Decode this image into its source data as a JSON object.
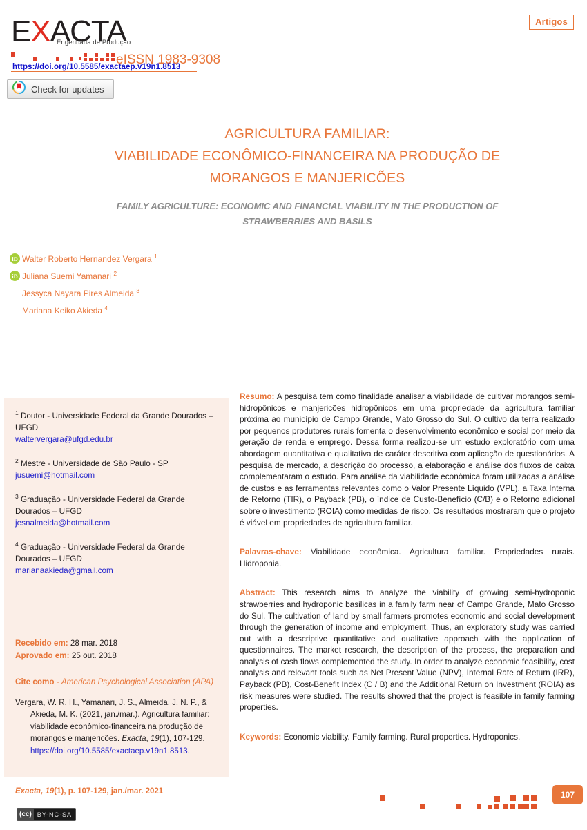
{
  "header": {
    "section_badge": "Artigos",
    "logo": {
      "wordmark_pre": "E",
      "wordmark_x": "X",
      "wordmark_post": "ACTA",
      "tagline": "Engenharia de Produção",
      "issn": "eISSN 1983-9308"
    },
    "doi_link": "https://doi.org/10.5585/exactaep.v19n1.8513",
    "crossmark_label": "Check for updates",
    "crossmark_icon": "crossmark-icon"
  },
  "title": {
    "pt_line1": "AGRICULTURA FAMILIAR:",
    "pt_line2": "VIABILIDADE ECONÔMICO-FINANCEIRA NA PRODUÇÃO DE",
    "pt_line3": "MORANGOS E MANJERICÕES",
    "en_line1": "FAMILY AGRICULTURE: ECONOMIC AND FINANCIAL VIABILITY IN THE PRODUCTION OF",
    "en_line2": "STRAWBERRIES AND BASILS"
  },
  "authors": [
    {
      "name": "Walter Roberto Hernandez Vergara",
      "marker": "1",
      "orcid": true,
      "orcid_label": "iD"
    },
    {
      "name": "Juliana Suemi Yamanari",
      "marker": "2",
      "orcid": true,
      "orcid_label": "iD"
    },
    {
      "name": "Jessyca Nayara Pires Almeida",
      "marker": "3",
      "orcid": false,
      "orcid_label": ""
    },
    {
      "name": "Mariana Keiko Akieda",
      "marker": "4",
      "orcid": false,
      "orcid_label": ""
    }
  ],
  "affiliations": [
    {
      "marker": "1",
      "text": "Doutor - Universidade Federal da Grande Dourados – UFGD",
      "email": "waltervergara@ufgd.edu.br"
    },
    {
      "marker": "2",
      "text": "Mestre - Universidade de São Paulo - SP",
      "email": "jusuemi@hotmail.com"
    },
    {
      "marker": "3",
      "text": "Graduação - Universidade Federal da Grande Dourados – UFGD",
      "email": "jesnalmeida@hotmail.com"
    },
    {
      "marker": "4",
      "text": "Graduação - Universidade Federal da Grande Dourados – UFGD",
      "email": "marianaakieda@gmail.com"
    }
  ],
  "dates": {
    "received_label": "Recebido em:",
    "received_value": "28 mar. 2018",
    "approved_label": "Aprovado em:",
    "approved_value": "25 out. 2018"
  },
  "citation": {
    "head_label": "Cite como -",
    "head_style": "American Psychological Association (APA)",
    "authors": "Vergara, W. R. H., Yamanari, J. S., Almeida, J. N. P., & Akieda, M. K.",
    "year": "(2021, jan./mar.).",
    "article_title": "Agricultura familiar: viabilidade econômico-financeira na produção de morangos e manjericões.",
    "journal": "Exacta",
    "volume": "19",
    "issue": "(1),",
    "pages": "107-129.",
    "doi": "https://doi.org/10.5585/exactaep.v19n1.8513."
  },
  "abstract_pt": {
    "label": "Resumo:",
    "text": "A pesquisa tem como finalidade analisar a viabilidade de cultivar morangos semi-hidropônicos e manjericões hidropônicos em uma propriedade da agricultura familiar próxima ao município de Campo Grande, Mato Grosso do Sul. O cultivo da terra realizado por pequenos produtores rurais fomenta o desenvolvimento econômico e social por meio da geração de renda e emprego. Dessa forma realizou-se um estudo exploratório com uma abordagem quantitativa e qualitativa de caráter descritiva com aplicação de questionários. A pesquisa de mercado, a descrição do processo, a elaboração e análise dos fluxos de caixa complementaram o estudo. Para análise da viabilidade econômica foram utilizadas a análise de custos e as ferramentas relevantes como o Valor Presente Líquido (VPL), a Taxa Interna de Retorno (TIR), o Payback (PB), o índice de Custo-Benefício (C/B) e o Retorno adicional sobre o investimento (ROIA) como medidas de risco. Os resultados mostraram que o projeto é viável em propriedades de agricultura familiar."
  },
  "keywords_pt": {
    "label": "Palavras-chave:",
    "text": "Viabilidade econômica. Agricultura familiar. Propriedades rurais. Hidroponia."
  },
  "abstract_en": {
    "label": "Abstract:",
    "text": "This research aims to analyze the viability of growing semi-hydroponic strawberries and hydroponic basilicas in a family farm near of Campo Grande, Mato Grosso do Sul. The cultivation of land by small farmers promotes economic and social development through the generation of income and employment. Thus, an exploratory study was carried out with a descriptive quantitative and qualitative approach with the application of questionnaires. The market research, the description of the process, the preparation and analysis of cash flows complemented the study. In order to analyze economic feasibility, cost analysis and relevant tools such as Net Present Value (NPV), Internal Rate of Return (IRR), Payback (PB), Cost-Benefit Index (C / B) and the Additional Return on Investment (ROIA) as risk measures were studied. The results showed that the project is feasible in family farming properties."
  },
  "keywords_en": {
    "label": "Keywords:",
    "text": "Economic viability. Family farming. Rural properties. Hydroponics."
  },
  "footer": {
    "journal": "Exacta,",
    "volume": "19",
    "issue_pages": "(1), p. 107-129, jan./mar. 2021",
    "page_number": "107",
    "license_left": "(cc)",
    "license_right": "BY-NC-SA"
  },
  "colors": {
    "accent_orange": "#e8763a",
    "logo_red": "#e02b20",
    "panel_bg": "#fbeee7",
    "link_blue": "#2323cc",
    "orcid_green": "#a6ce39",
    "subtitle_gray": "#8d8d8d"
  }
}
